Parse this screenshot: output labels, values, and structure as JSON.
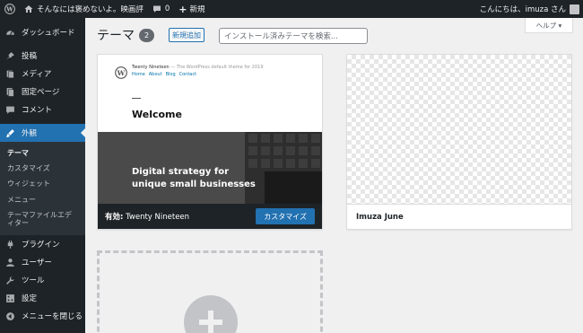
{
  "admin_bar": {
    "site_name": "そんなには褒めないよ。映画評",
    "comment_count": "0",
    "new_label": "新規",
    "greeting": "こんにちは、imuza さん"
  },
  "sidebar": {
    "items": [
      {
        "label": "ダッシュボード",
        "icon": "dashboard-icon"
      },
      {
        "label": "投稿",
        "icon": "pin-icon"
      },
      {
        "label": "メディア",
        "icon": "media-icon"
      },
      {
        "label": "固定ページ",
        "icon": "page-icon"
      },
      {
        "label": "コメント",
        "icon": "comment-icon"
      },
      {
        "label": "外観",
        "icon": "brush-icon"
      },
      {
        "label": "プラグイン",
        "icon": "plugin-icon"
      },
      {
        "label": "ユーザー",
        "icon": "user-icon"
      },
      {
        "label": "ツール",
        "icon": "wrench-icon"
      },
      {
        "label": "設定",
        "icon": "settings-icon"
      },
      {
        "label": "メニューを閉じる",
        "icon": "collapse-icon"
      }
    ],
    "submenu": [
      {
        "label": "テーマ"
      },
      {
        "label": "カスタマイズ"
      },
      {
        "label": "ウィジェット"
      },
      {
        "label": "メニュー"
      },
      {
        "label": "テーマファイルエディター"
      }
    ]
  },
  "main": {
    "title": "テーマ",
    "count": "2",
    "add_new_label": "新規追加",
    "search_placeholder": "インストール済みテーマを検索...",
    "help_label": "ヘルプ ▾"
  },
  "themes": [
    {
      "name": "Twenty Nineteen",
      "active_prefix": "有効:",
      "customize_label": "カスタマイズ",
      "preview": {
        "site_name": "Twenty Nineteen",
        "tagline": "— The WordPress default theme for 2019",
        "nav": [
          "Home",
          "About",
          "Blog",
          "Contact"
        ],
        "welcome": "Welcome",
        "hero_text": "Digital strategy for\nunique small businesses"
      }
    },
    {
      "name": "Imuza June"
    }
  ],
  "colors": {
    "admin_dark": "#1d2327",
    "accent": "#2271b1",
    "page_bg": "#f0f0f1"
  }
}
